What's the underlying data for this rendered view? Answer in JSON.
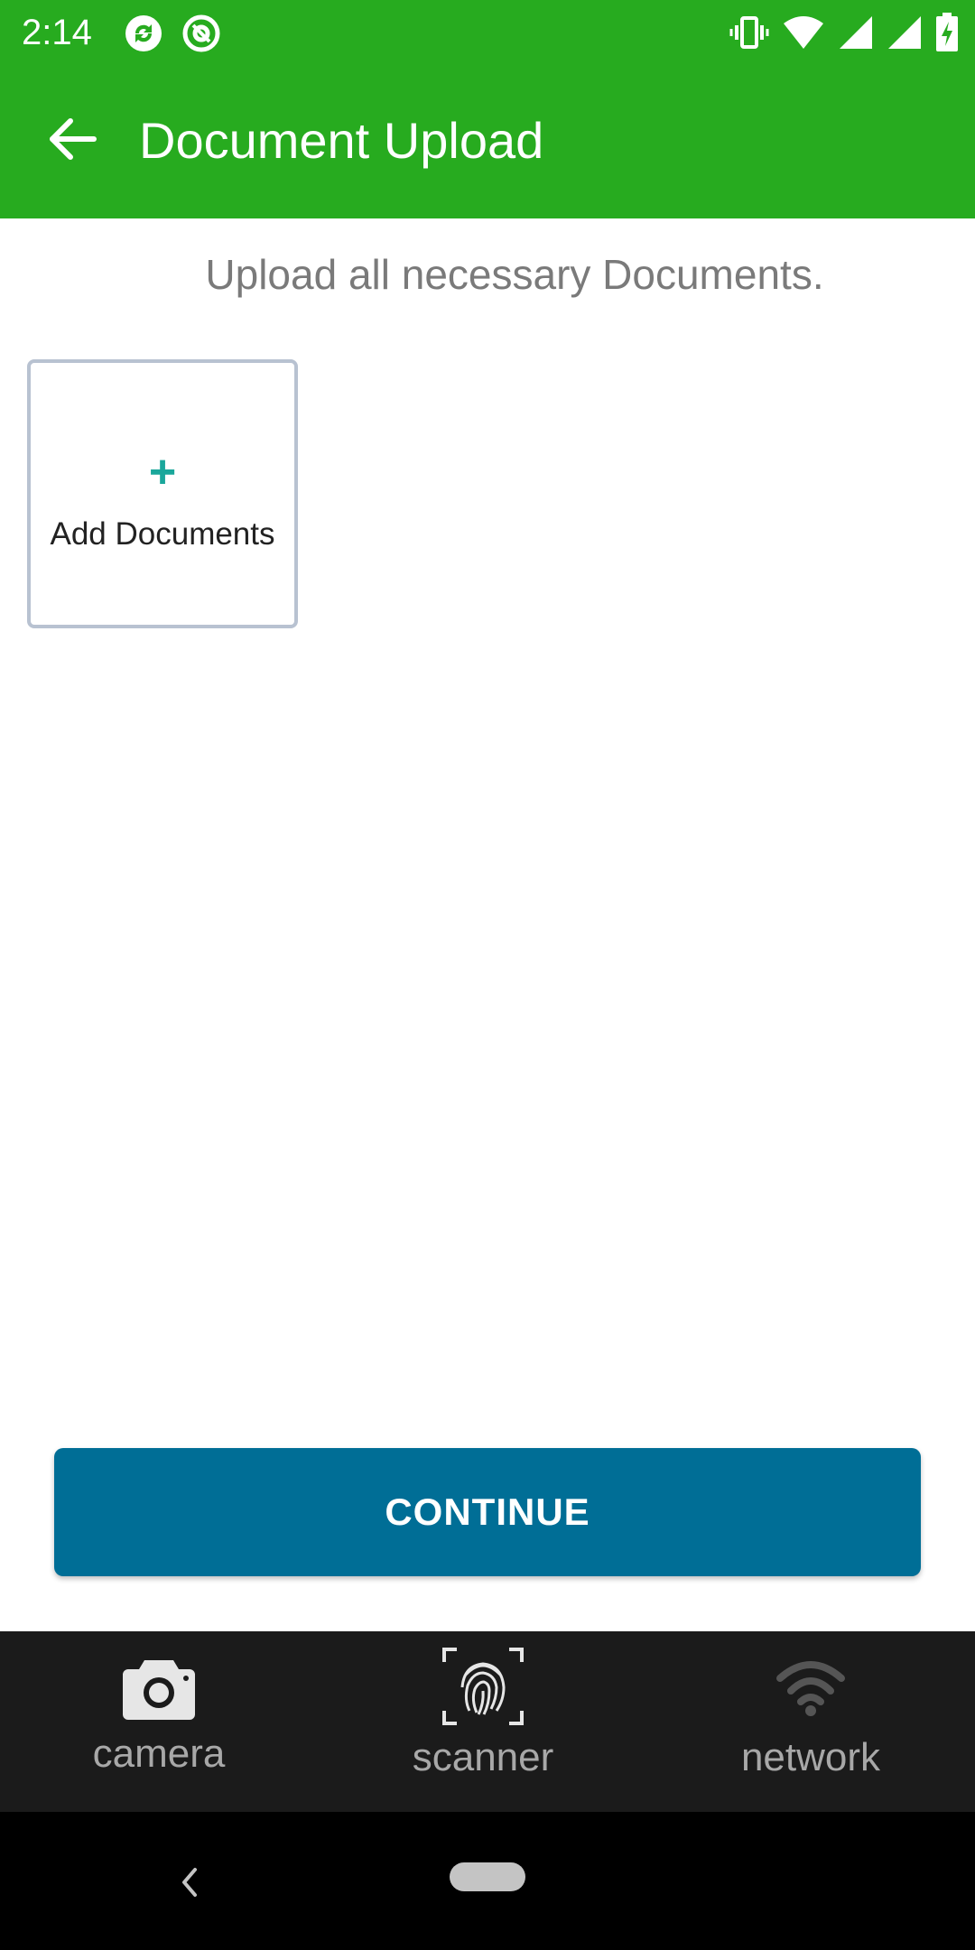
{
  "status_bar": {
    "time": "2:14",
    "left_icons": [
      "sync-icon",
      "at-sign-icon"
    ],
    "right_icons": [
      "vibrate-icon",
      "wifi-icon",
      "signal-icon",
      "signal-icon",
      "battery-charging-icon"
    ]
  },
  "app_bar": {
    "title": "Document Upload",
    "back_icon": "arrow-left-icon",
    "color": "#27ab1f"
  },
  "main": {
    "instruction": "Upload all necessary Documents.",
    "add_card": {
      "plus": "+",
      "label": "Add Documents"
    },
    "continue_label": "CONTINUE",
    "continue_color": "#006e96"
  },
  "bottom_nav": {
    "items": [
      {
        "label": "camera",
        "icon": "camera-icon"
      },
      {
        "label": "scanner",
        "icon": "fingerprint-icon"
      },
      {
        "label": "network",
        "icon": "wifi-icon"
      }
    ]
  },
  "system_nav": {
    "back_icon": "chevron-left-icon",
    "home_icon": "home-pill-icon"
  }
}
